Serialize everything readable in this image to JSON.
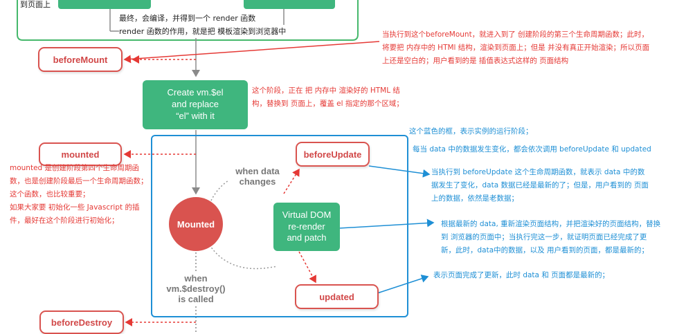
{
  "top": {
    "left_fragment": "到页面上",
    "compile_note_1": "最终，会编译，并得到一个 render 函数",
    "compile_note_2": "render 函数的作用，就是把 模板渲染到浏览器中"
  },
  "nodes": {
    "before_mount": "beforeMount",
    "create_el_lines": [
      "Create vm.$el",
      "and replace",
      "“el” with it"
    ],
    "mounted_hook": "mounted",
    "before_update": "beforeUpdate",
    "mounted_circle": "Mounted",
    "virtual_dom_lines": [
      "Virtual DOM",
      "re-render",
      "and patch"
    ],
    "updated": "updated",
    "before_destroy": "beforeDestroy",
    "when_data_changes": "when data\nchanges",
    "when_destroy": "when\nvm.$destroy()\nis called"
  },
  "notes": {
    "before_mount_note": "当执行到这个beforeMount，就进入到了 创建阶段的第三个生命周期函数；此时，\n将要把 内存中的 HTMl 结构，渲染到页面上；但是 并没有真正开始渲染；所以页面\n上还是空白的；用户看到的是 插值表达式这样的 页面结构",
    "create_el_note": "这个阶段，正在 把 内存中 渲染好的 HTML 结\n构，替换到 页面上，覆盖 el 指定的那个区域；",
    "blue_frame_note": "这个蓝色的框，表示实例的运行阶段；",
    "data_change_note": "每当 data 中的数据发生变化，都会依次调用 beforeUpdate 和 updated",
    "before_update_note": "当执行到 beforeUpdate 这个生命周期函数，就表示 data 中的数\n据发生了变化，data 数据已经是最新的了；但是，用户看到的 页面\n上的数据，依然是老数据；",
    "vdom_note": "根据最新的 data, 重新渲染页面结构，并把渲染好的页面结构，替换\n到 浏览器的页面中；当执行完这一步，就证明页面已经完成了更\n新，此时，data中的数据，以及 用户看到的页面，都是最新的；",
    "updated_note": "表示页面完成了更新，此时 data 和 页面都是最新的；",
    "mounted_note": "mounted 是创建阶段第四个生命周期函\n数，也是创建阶段最后一个生命周期函数；\n这个函数，也比较重要；\n如果大家要 初始化一些 Javascript 的插\n件，最好在这个阶段进行初始化；"
  },
  "colors": {
    "green": "#3fb67e",
    "red": "#e53935",
    "blue": "#1e8fd5",
    "frame_green": "#45b86b"
  }
}
